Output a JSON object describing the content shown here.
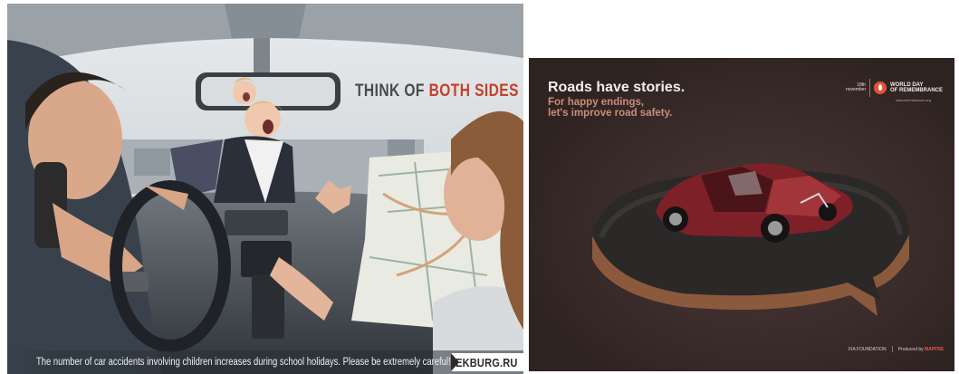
{
  "ad_left": {
    "headline_part1": "THINK OF ",
    "headline_part2": "BOTH SIDES",
    "caption": "The number of car accidents involving children increases during school holidays. Please be extremely careful!",
    "brand": "EKBURG.RU",
    "colors": {
      "headline_dark": "#4a4a4a",
      "headline_accent": "#c2412d"
    }
  },
  "ad_right": {
    "title": "Roads have stories.",
    "subtitle_line1": "For happy endings,",
    "subtitle_line2": "let's improve road safety.",
    "logo_date_line1": "18th",
    "logo_date_line2": "november",
    "logo_org_line1": "WORLD DAY",
    "logo_org_line2": "OF REMEMBRANCE",
    "logo_url": "wdoremembrance.org",
    "footer_left": "FIA FOUNDATION",
    "footer_right_prefix": "Produced by",
    "footer_right_brand": "MAPFRE",
    "colors": {
      "background": "#3a2c2b",
      "subtitle": "#c98d79",
      "logo_red": "#e2513a"
    }
  }
}
